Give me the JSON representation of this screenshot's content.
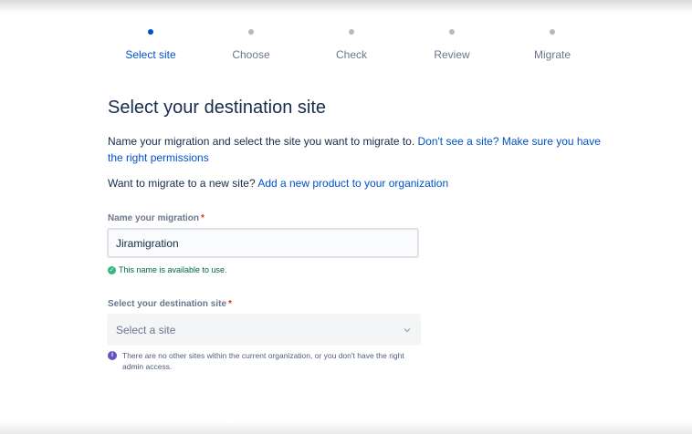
{
  "stepper": {
    "steps": [
      {
        "label": "Select site",
        "active": true
      },
      {
        "label": "Choose",
        "active": false
      },
      {
        "label": "Check",
        "active": false
      },
      {
        "label": "Review",
        "active": false
      },
      {
        "label": "Migrate",
        "active": false
      }
    ]
  },
  "page": {
    "title": "Select your destination site",
    "intro_text": "Name your migration and select the site you want to migrate to. ",
    "intro_link": "Don't see a site? Make sure you have the right permissions",
    "new_site_text": "Want to migrate to a new site? ",
    "new_site_link": "Add a new product to your organization"
  },
  "form": {
    "migration_name": {
      "label": "Name your migration",
      "required_mark": "*",
      "value": "Jiramigration",
      "valid_message": "This name is available to use."
    },
    "destination_site": {
      "label": "Select your destination site",
      "required_mark": "*",
      "placeholder": "Select a site",
      "info_message": "There are no other sites within the current organization, or you don't have the right admin access."
    }
  },
  "colors": {
    "accent": "#0052cc",
    "step_inactive": "#b3bac5",
    "success": "#36b37e",
    "info": "#6554c0",
    "required": "#de350b"
  },
  "icons": {
    "valid": "check-circle-icon",
    "info": "info-circle-icon",
    "select": "chevron-down-icon"
  }
}
